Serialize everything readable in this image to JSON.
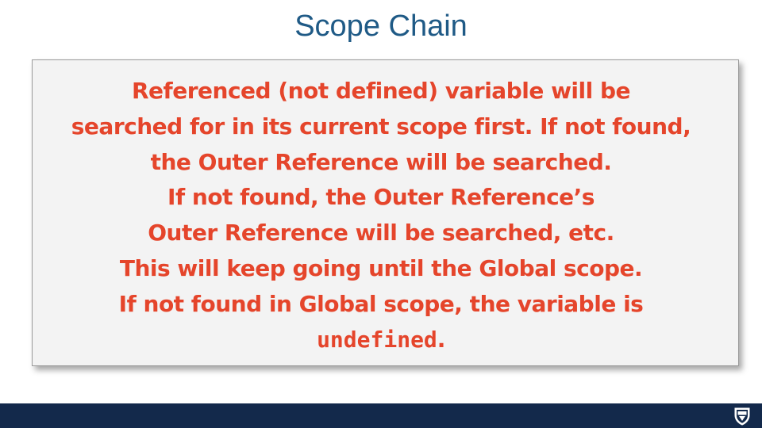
{
  "slide": {
    "title": "Scope Chain",
    "body": {
      "line1": "Referenced (not defined) variable will be",
      "line2": "searched for in its current scope first. If not found,",
      "line3": "the Outer Reference will be searched.",
      "line4": "If not found, the Outer Reference’s",
      "line5": "Outer Reference will be searched, etc.",
      "line6": "This will keep going until the Global scope.",
      "line7": "If not found in Global scope, the variable is",
      "line8_code": "undefined",
      "line8_suffix": "."
    }
  },
  "colors": {
    "title": "#1f5a86",
    "body_text": "#e5452b",
    "box_background": "#f3f3f3",
    "footer": "#13294b"
  },
  "footer": {
    "logo_icon": "university-shield-icon"
  }
}
